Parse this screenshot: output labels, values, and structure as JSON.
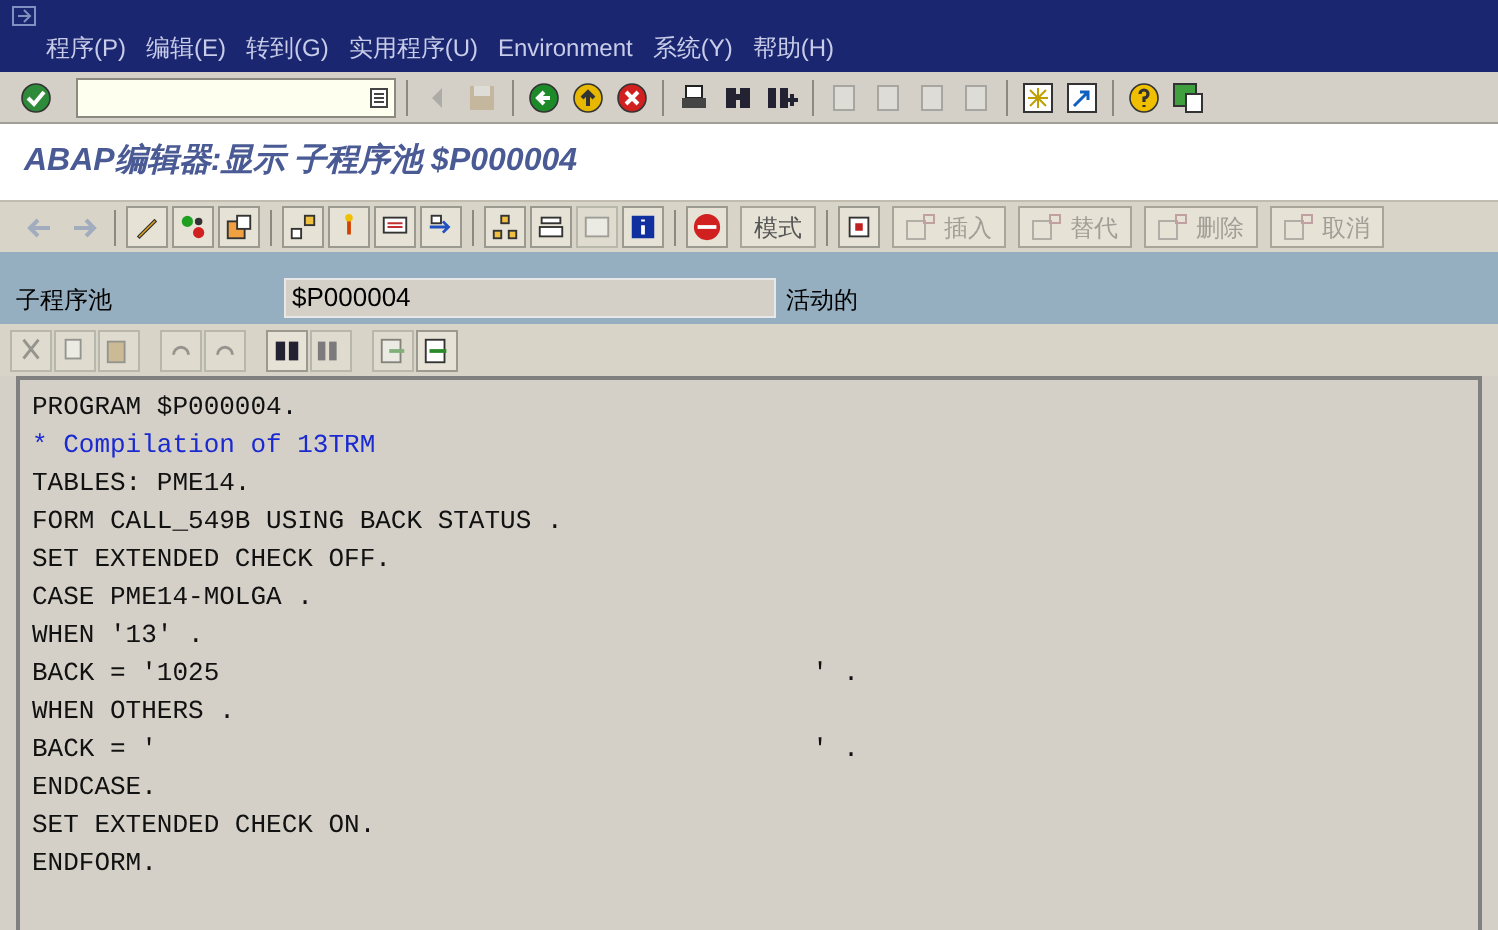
{
  "menu": [
    "程序(P)",
    "编辑(E)",
    "转到(G)",
    "实用程序(U)",
    "Environment",
    "系统(Y)",
    "帮助(H)"
  ],
  "screen_title": "ABAP编辑器:显示 子程序池 $P000004",
  "app_buttons": [
    {
      "label": "模式",
      "disabled": false
    },
    {
      "label": "插入",
      "disabled": true
    },
    {
      "label": "替代",
      "disabled": true
    },
    {
      "label": "删除",
      "disabled": true
    },
    {
      "label": "取消",
      "disabled": true
    }
  ],
  "program_field": {
    "label": "子程序池",
    "value": "$P000004",
    "status": "活动的"
  },
  "code_lines": [
    {
      "kind": "code",
      "text": "PROGRAM $P000004."
    },
    {
      "kind": "comment",
      "text": "* Compilation of 13TRM"
    },
    {
      "kind": "code",
      "text": "TABLES: PME14."
    },
    {
      "kind": "code",
      "text": "FORM CALL_549B USING BACK STATUS ."
    },
    {
      "kind": "code",
      "text": "SET EXTENDED CHECK OFF."
    },
    {
      "kind": "code",
      "text": "CASE PME14-MOLGA ."
    },
    {
      "kind": "code",
      "text": "WHEN '13' ."
    },
    {
      "kind": "code",
      "text": "BACK = '1025                                      ' ."
    },
    {
      "kind": "code",
      "text": "WHEN OTHERS ."
    },
    {
      "kind": "code",
      "text": "BACK = '                                          ' ."
    },
    {
      "kind": "code",
      "text": "ENDCASE."
    },
    {
      "kind": "code",
      "text": "SET EXTENDED CHECK ON."
    },
    {
      "kind": "code",
      "text": "ENDFORM."
    }
  ]
}
